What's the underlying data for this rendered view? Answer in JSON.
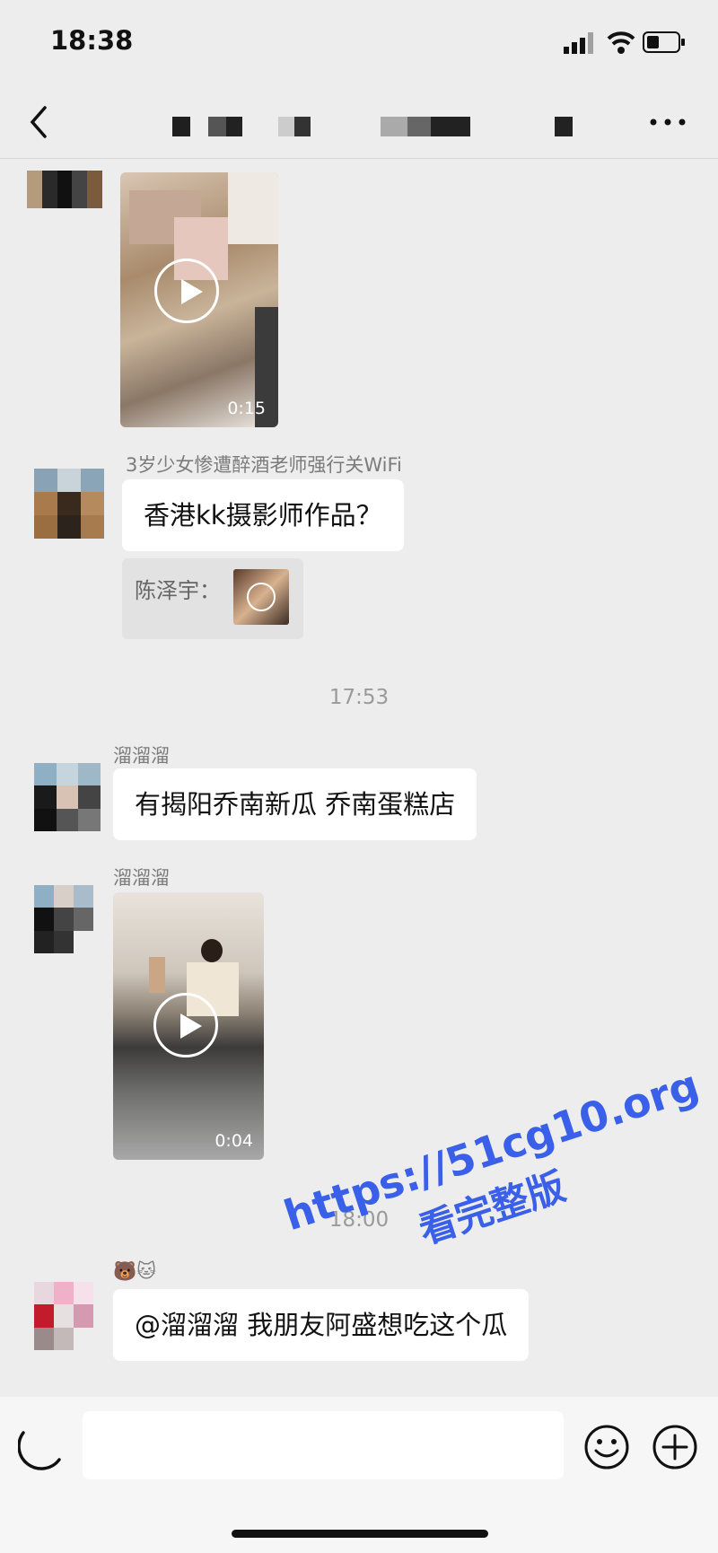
{
  "status_bar": {
    "time": "18:38"
  },
  "nav": {
    "title": ""
  },
  "messages": {
    "video1": {
      "duration": "0:15"
    },
    "quote_title": "3岁少女惨遭醉酒老师强行关WiFi",
    "msg2": {
      "text": "香港kk摄影师作品？",
      "quote_name": "陈泽宇："
    },
    "time1": "17:53",
    "msg3": {
      "sender": "溜溜溜",
      "text": "有揭阳乔南新瓜  乔南蛋糕店"
    },
    "msg4": {
      "sender": "溜溜溜",
      "duration": "0:04"
    },
    "time2": "18:00",
    "msg5": {
      "sender": "🐻🐱",
      "text": "@溜溜溜 我朋友阿盛想吃这个瓜"
    }
  },
  "watermark": {
    "line1": "https://51cg10.org",
    "line2": "看完整版"
  },
  "icons": [
    "back-icon",
    "more-icon",
    "signal-icon",
    "wifi-icon",
    "battery-icon",
    "play-icon",
    "voice-icon",
    "emoji-icon",
    "add-icon"
  ]
}
